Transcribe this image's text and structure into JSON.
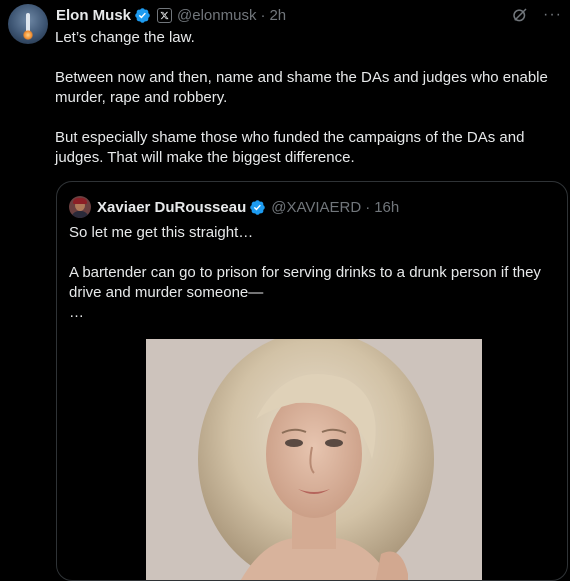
{
  "post": {
    "author": {
      "name": "Elon Musk",
      "handle": "@elonmusk",
      "time": "2h"
    },
    "separator": "·",
    "text": "Let’s change the law.\n\nBetween now and then, name and shame the DAs and judges who enable murder, rape and robbery.\n\nBut especially shame those who funded the campaigns of the DAs and judges. That will make the biggest difference.",
    "icons": [
      "grok-icon",
      "more-icon"
    ],
    "more_glyph": "···"
  },
  "quoted_post": {
    "author": {
      "name": "Xaviaer DuRousseau",
      "handle": "@XAVIAERD",
      "time": "16h"
    },
    "text": "So let me get this straight…\n\nA bartender can go to prison for serving drinks to a drunk person if they drive and murder someone—\n…"
  },
  "colors": {
    "background": "#000000",
    "text": "#e7e9ea",
    "secondary_text": "#71767b",
    "verified_badge": "#1d9bf0",
    "border": "#2f3336"
  }
}
